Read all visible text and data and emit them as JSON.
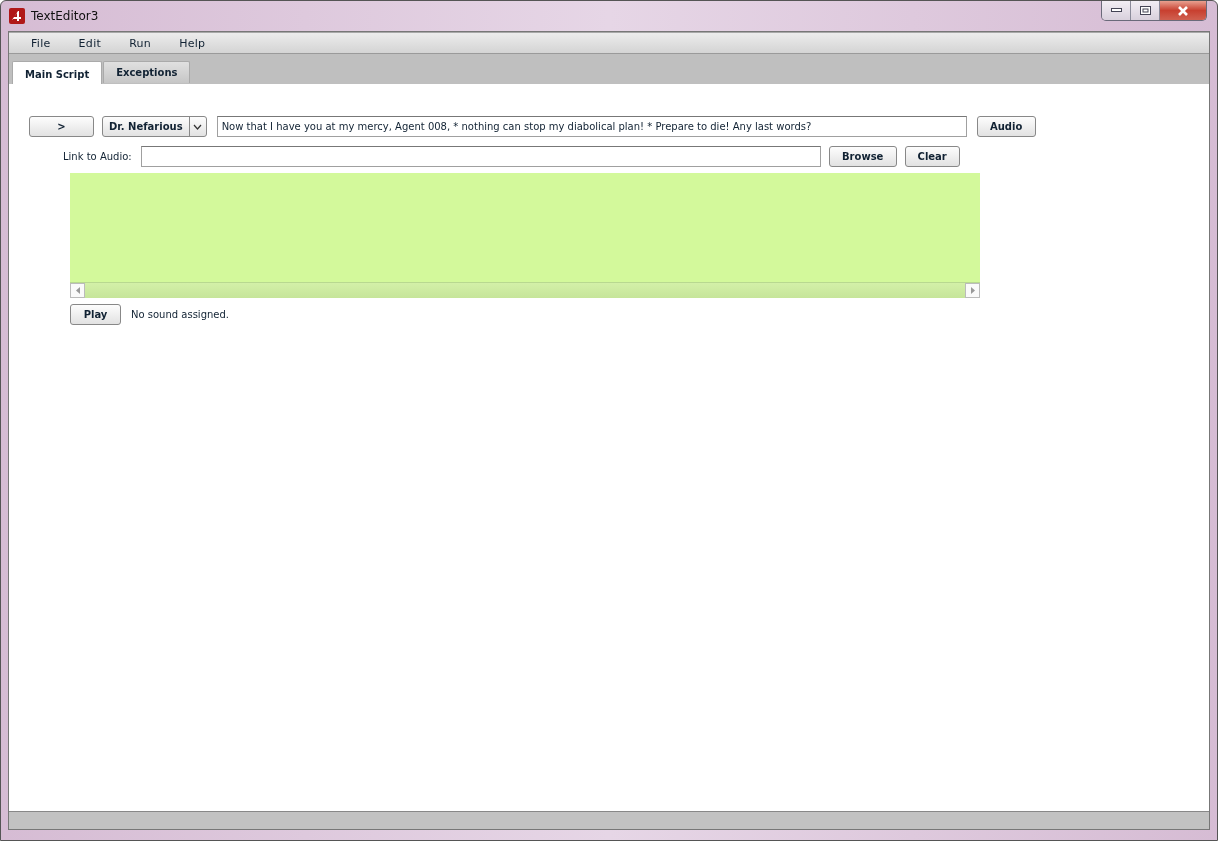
{
  "window": {
    "title": "TextEditor3"
  },
  "menu": [
    "File",
    "Edit",
    "Run",
    "Help"
  ],
  "tabs": [
    {
      "label": "Main Script",
      "selected": true
    },
    {
      "label": "Exceptions",
      "selected": false
    }
  ],
  "script_line": {
    "run_button": ">",
    "speaker": "Dr. Nefarious",
    "text": "Now that I have you at my mercy, Agent 008, * nothing can stop my diabolical plan! * Prepare to die! Any last words?",
    "audio_button": "Audio"
  },
  "audio_link": {
    "label": "Link to Audio:",
    "browse_button": "Browse",
    "clear_button": "Clear"
  },
  "playback": {
    "play_button": "Play",
    "status": "No sound assigned."
  }
}
